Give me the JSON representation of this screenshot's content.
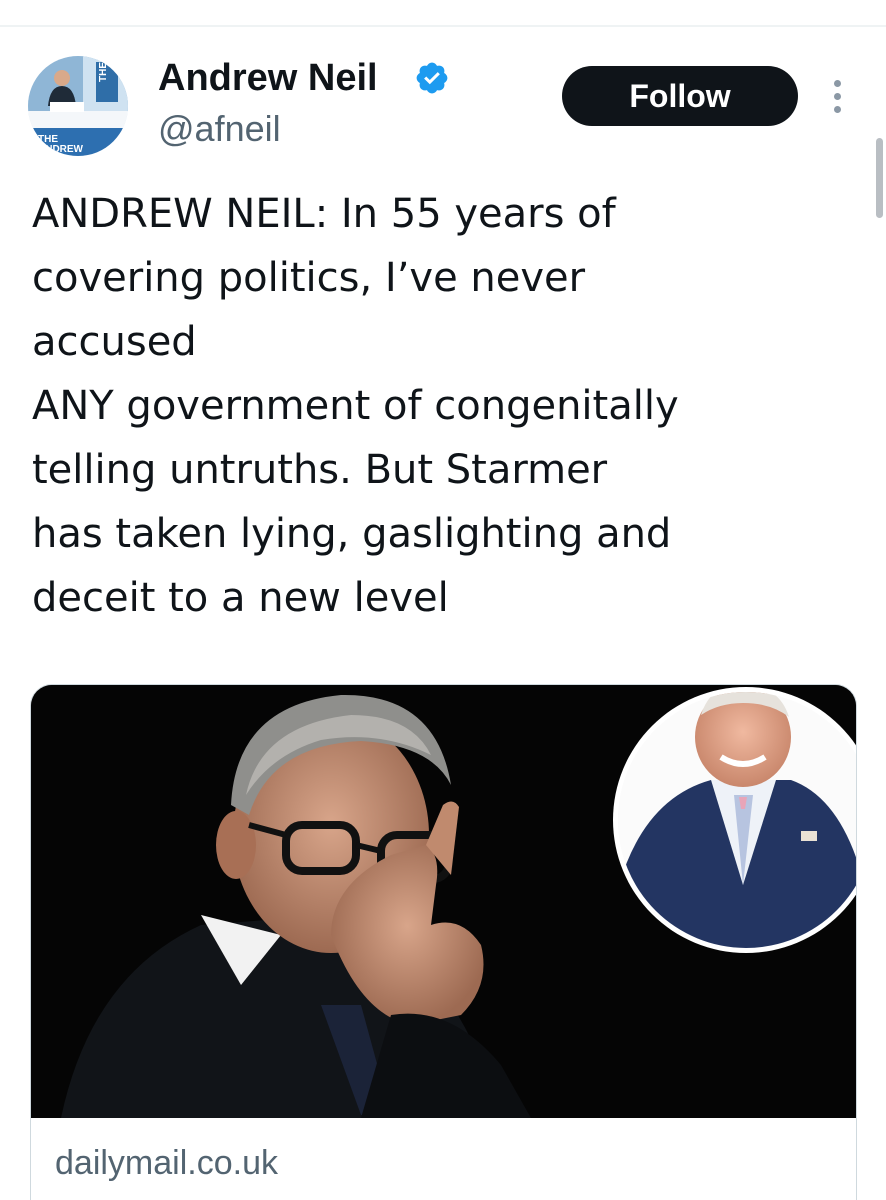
{
  "author": {
    "display_name": "Andrew Neil",
    "handle": "@afneil",
    "verified": true,
    "avatar_badge_text": "THE ANDREW NEIL"
  },
  "actions": {
    "follow_label": "Follow"
  },
  "tweet": {
    "lines": [
      "ANDREW NEIL: In 55 years of",
      "covering politics, I’ve never",
      "accused",
      "ANY government of congenitally",
      "telling untruths. But Starmer",
      "has taken lying, gaslighting and",
      "deceit to a new level"
    ]
  },
  "link_card": {
    "domain": "dailymail.co.uk"
  },
  "colors": {
    "verified_badge": "#1d9bf0",
    "follow_button_bg": "#0f1419",
    "secondary_text": "#536471"
  }
}
